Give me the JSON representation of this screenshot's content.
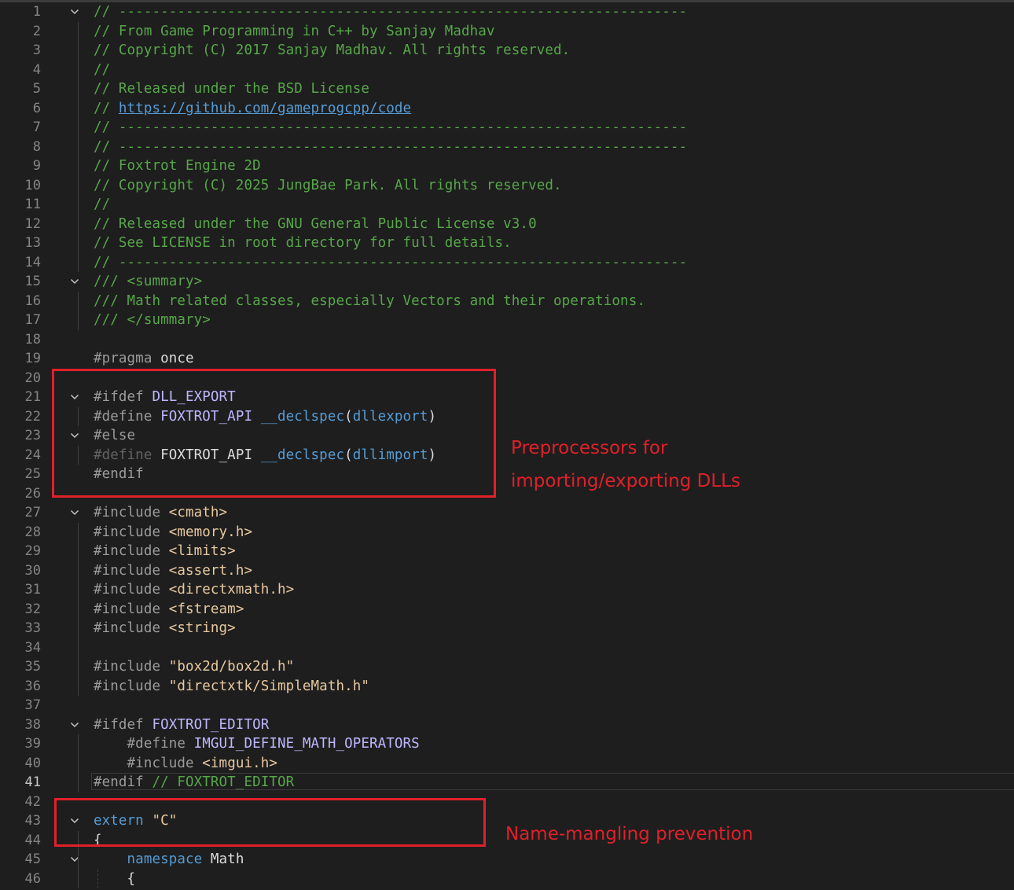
{
  "editor": {
    "lines": [
      {
        "n": "1",
        "fold": true,
        "segs": [
          {
            "c": "c-com",
            "t": "// --------------------------------------------------------------------"
          }
        ]
      },
      {
        "n": "2",
        "segs": [
          {
            "c": "c-com",
            "t": "// From Game Programming in C++ by Sanjay Madhav"
          }
        ]
      },
      {
        "n": "3",
        "segs": [
          {
            "c": "c-com",
            "t": "// Copyright (C) 2017 Sanjay Madhav. All rights reserved."
          }
        ]
      },
      {
        "n": "4",
        "segs": [
          {
            "c": "c-com",
            "t": "//"
          }
        ]
      },
      {
        "n": "5",
        "segs": [
          {
            "c": "c-com",
            "t": "// Released under the BSD License"
          }
        ]
      },
      {
        "n": "6",
        "segs": [
          {
            "c": "c-com",
            "t": "// "
          },
          {
            "c": "c-link",
            "t": "https://github.com/gameprogcpp/code"
          }
        ]
      },
      {
        "n": "7",
        "segs": [
          {
            "c": "c-com",
            "t": "// --------------------------------------------------------------------"
          }
        ]
      },
      {
        "n": "8",
        "segs": [
          {
            "c": "c-com",
            "t": "// --------------------------------------------------------------------"
          }
        ]
      },
      {
        "n": "9",
        "segs": [
          {
            "c": "c-com",
            "t": "// Foxtrot Engine 2D"
          }
        ]
      },
      {
        "n": "10",
        "segs": [
          {
            "c": "c-com",
            "t": "// Copyright (C) 2025 JungBae Park. All rights reserved."
          }
        ]
      },
      {
        "n": "11",
        "segs": [
          {
            "c": "c-com",
            "t": "//"
          }
        ]
      },
      {
        "n": "12",
        "segs": [
          {
            "c": "c-com",
            "t": "// Released under the GNU General Public License v3.0"
          }
        ]
      },
      {
        "n": "13",
        "segs": [
          {
            "c": "c-com",
            "t": "// See LICENSE in root directory for full details."
          }
        ]
      },
      {
        "n": "14",
        "segs": [
          {
            "c": "c-com",
            "t": "// --------------------------------------------------------------------"
          }
        ]
      },
      {
        "n": "15",
        "fold": true,
        "segs": [
          {
            "c": "c-com",
            "t": "/// <summary>"
          }
        ]
      },
      {
        "n": "16",
        "segs": [
          {
            "c": "c-com",
            "t": "/// Math related classes, especially Vectors and their operations."
          }
        ]
      },
      {
        "n": "17",
        "segs": [
          {
            "c": "c-com",
            "t": "/// </summary>"
          }
        ]
      },
      {
        "n": "18",
        "segs": []
      },
      {
        "n": "19",
        "segs": [
          {
            "c": "c-pp",
            "t": "#pragma "
          },
          {
            "c": "c-plain",
            "t": "once"
          }
        ]
      },
      {
        "n": "20",
        "segs": []
      },
      {
        "n": "21",
        "fold": true,
        "segs": [
          {
            "c": "c-pp",
            "t": "#ifdef "
          },
          {
            "c": "c-macro",
            "t": "DLL_EXPORT"
          }
        ]
      },
      {
        "n": "22",
        "segs": [
          {
            "c": "c-pp",
            "t": "#define "
          },
          {
            "c": "c-macro",
            "t": "FOXTROT_API "
          },
          {
            "c": "c-kw",
            "t": "__declspec"
          },
          {
            "c": "c-plain",
            "t": "("
          },
          {
            "c": "c-arg",
            "t": "dllexport"
          },
          {
            "c": "c-plain",
            "t": ")"
          }
        ]
      },
      {
        "n": "23",
        "fold": true,
        "segs": [
          {
            "c": "c-pp",
            "t": "#else"
          }
        ]
      },
      {
        "n": "24",
        "segs": [
          {
            "c": "c-pp c-dim",
            "t": "#define "
          },
          {
            "c": "c-plain",
            "t": "FOXTROT_API "
          },
          {
            "c": "c-kw",
            "t": "__declspec"
          },
          {
            "c": "c-plain",
            "t": "("
          },
          {
            "c": "c-arg",
            "t": "dllimport"
          },
          {
            "c": "c-plain",
            "t": ")"
          }
        ]
      },
      {
        "n": "25",
        "segs": [
          {
            "c": "c-pp",
            "t": "#endif"
          }
        ]
      },
      {
        "n": "26",
        "segs": []
      },
      {
        "n": "27",
        "fold": true,
        "segs": [
          {
            "c": "c-pp",
            "t": "#include "
          },
          {
            "c": "c-str",
            "t": "<cmath>"
          }
        ]
      },
      {
        "n": "28",
        "segs": [
          {
            "c": "c-pp",
            "t": "#include "
          },
          {
            "c": "c-str",
            "t": "<memory.h>"
          }
        ]
      },
      {
        "n": "29",
        "segs": [
          {
            "c": "c-pp",
            "t": "#include "
          },
          {
            "c": "c-str",
            "t": "<limits>"
          }
        ]
      },
      {
        "n": "30",
        "segs": [
          {
            "c": "c-pp",
            "t": "#include "
          },
          {
            "c": "c-str",
            "t": "<assert.h>"
          }
        ]
      },
      {
        "n": "31",
        "segs": [
          {
            "c": "c-pp",
            "t": "#include "
          },
          {
            "c": "c-str",
            "t": "<directxmath.h>"
          }
        ]
      },
      {
        "n": "32",
        "segs": [
          {
            "c": "c-pp",
            "t": "#include "
          },
          {
            "c": "c-str",
            "t": "<fstream>"
          }
        ]
      },
      {
        "n": "33",
        "segs": [
          {
            "c": "c-pp",
            "t": "#include "
          },
          {
            "c": "c-str",
            "t": "<string>"
          }
        ]
      },
      {
        "n": "34",
        "segs": []
      },
      {
        "n": "35",
        "segs": [
          {
            "c": "c-pp",
            "t": "#include "
          },
          {
            "c": "c-str",
            "t": "\"box2d/box2d.h\""
          }
        ]
      },
      {
        "n": "36",
        "segs": [
          {
            "c": "c-pp",
            "t": "#include "
          },
          {
            "c": "c-str",
            "t": "\"directxtk/SimpleMath.h\""
          }
        ]
      },
      {
        "n": "37",
        "segs": []
      },
      {
        "n": "38",
        "fold": true,
        "segs": [
          {
            "c": "c-pp",
            "t": "#ifdef "
          },
          {
            "c": "c-macro",
            "t": "FOXTROT_EDITOR"
          }
        ]
      },
      {
        "n": "39",
        "segs": [
          {
            "c": "c-plain",
            "t": "    "
          },
          {
            "c": "c-pp",
            "t": "#define "
          },
          {
            "c": "c-macro",
            "t": "IMGUI_DEFINE_MATH_OPERATORS"
          }
        ]
      },
      {
        "n": "40",
        "segs": [
          {
            "c": "c-plain",
            "t": "    "
          },
          {
            "c": "c-pp",
            "t": "#include "
          },
          {
            "c": "c-str",
            "t": "<imgui.h>"
          }
        ]
      },
      {
        "n": "41",
        "current": true,
        "segs": [
          {
            "c": "c-pp",
            "t": "#endif "
          },
          {
            "c": "c-com",
            "t": "// FOXTROT_EDITOR"
          }
        ]
      },
      {
        "n": "42",
        "segs": []
      },
      {
        "n": "43",
        "fold": true,
        "segs": [
          {
            "c": "c-kw2",
            "t": "extern "
          },
          {
            "c": "c-str",
            "t": "\"C\""
          }
        ]
      },
      {
        "n": "44",
        "segs": [
          {
            "c": "c-plain",
            "t": "{"
          }
        ]
      },
      {
        "n": "45",
        "fold": true,
        "segs": [
          {
            "c": "c-plain",
            "t": "    "
          },
          {
            "c": "c-kw2",
            "t": "namespace "
          },
          {
            "c": "c-plain",
            "t": "Math"
          }
        ]
      },
      {
        "n": "46",
        "segs": [
          {
            "c": "c-plain",
            "t": "    {"
          }
        ]
      }
    ]
  },
  "annotations": {
    "dll_line1": "Preprocessors for",
    "dll_line2": "importing/exporting DLLs",
    "mangling": "Name-mangling prevention"
  },
  "colors": {
    "background": "#1e1e1e",
    "comment": "#57a64a",
    "annotation_red": "#e0202a"
  }
}
